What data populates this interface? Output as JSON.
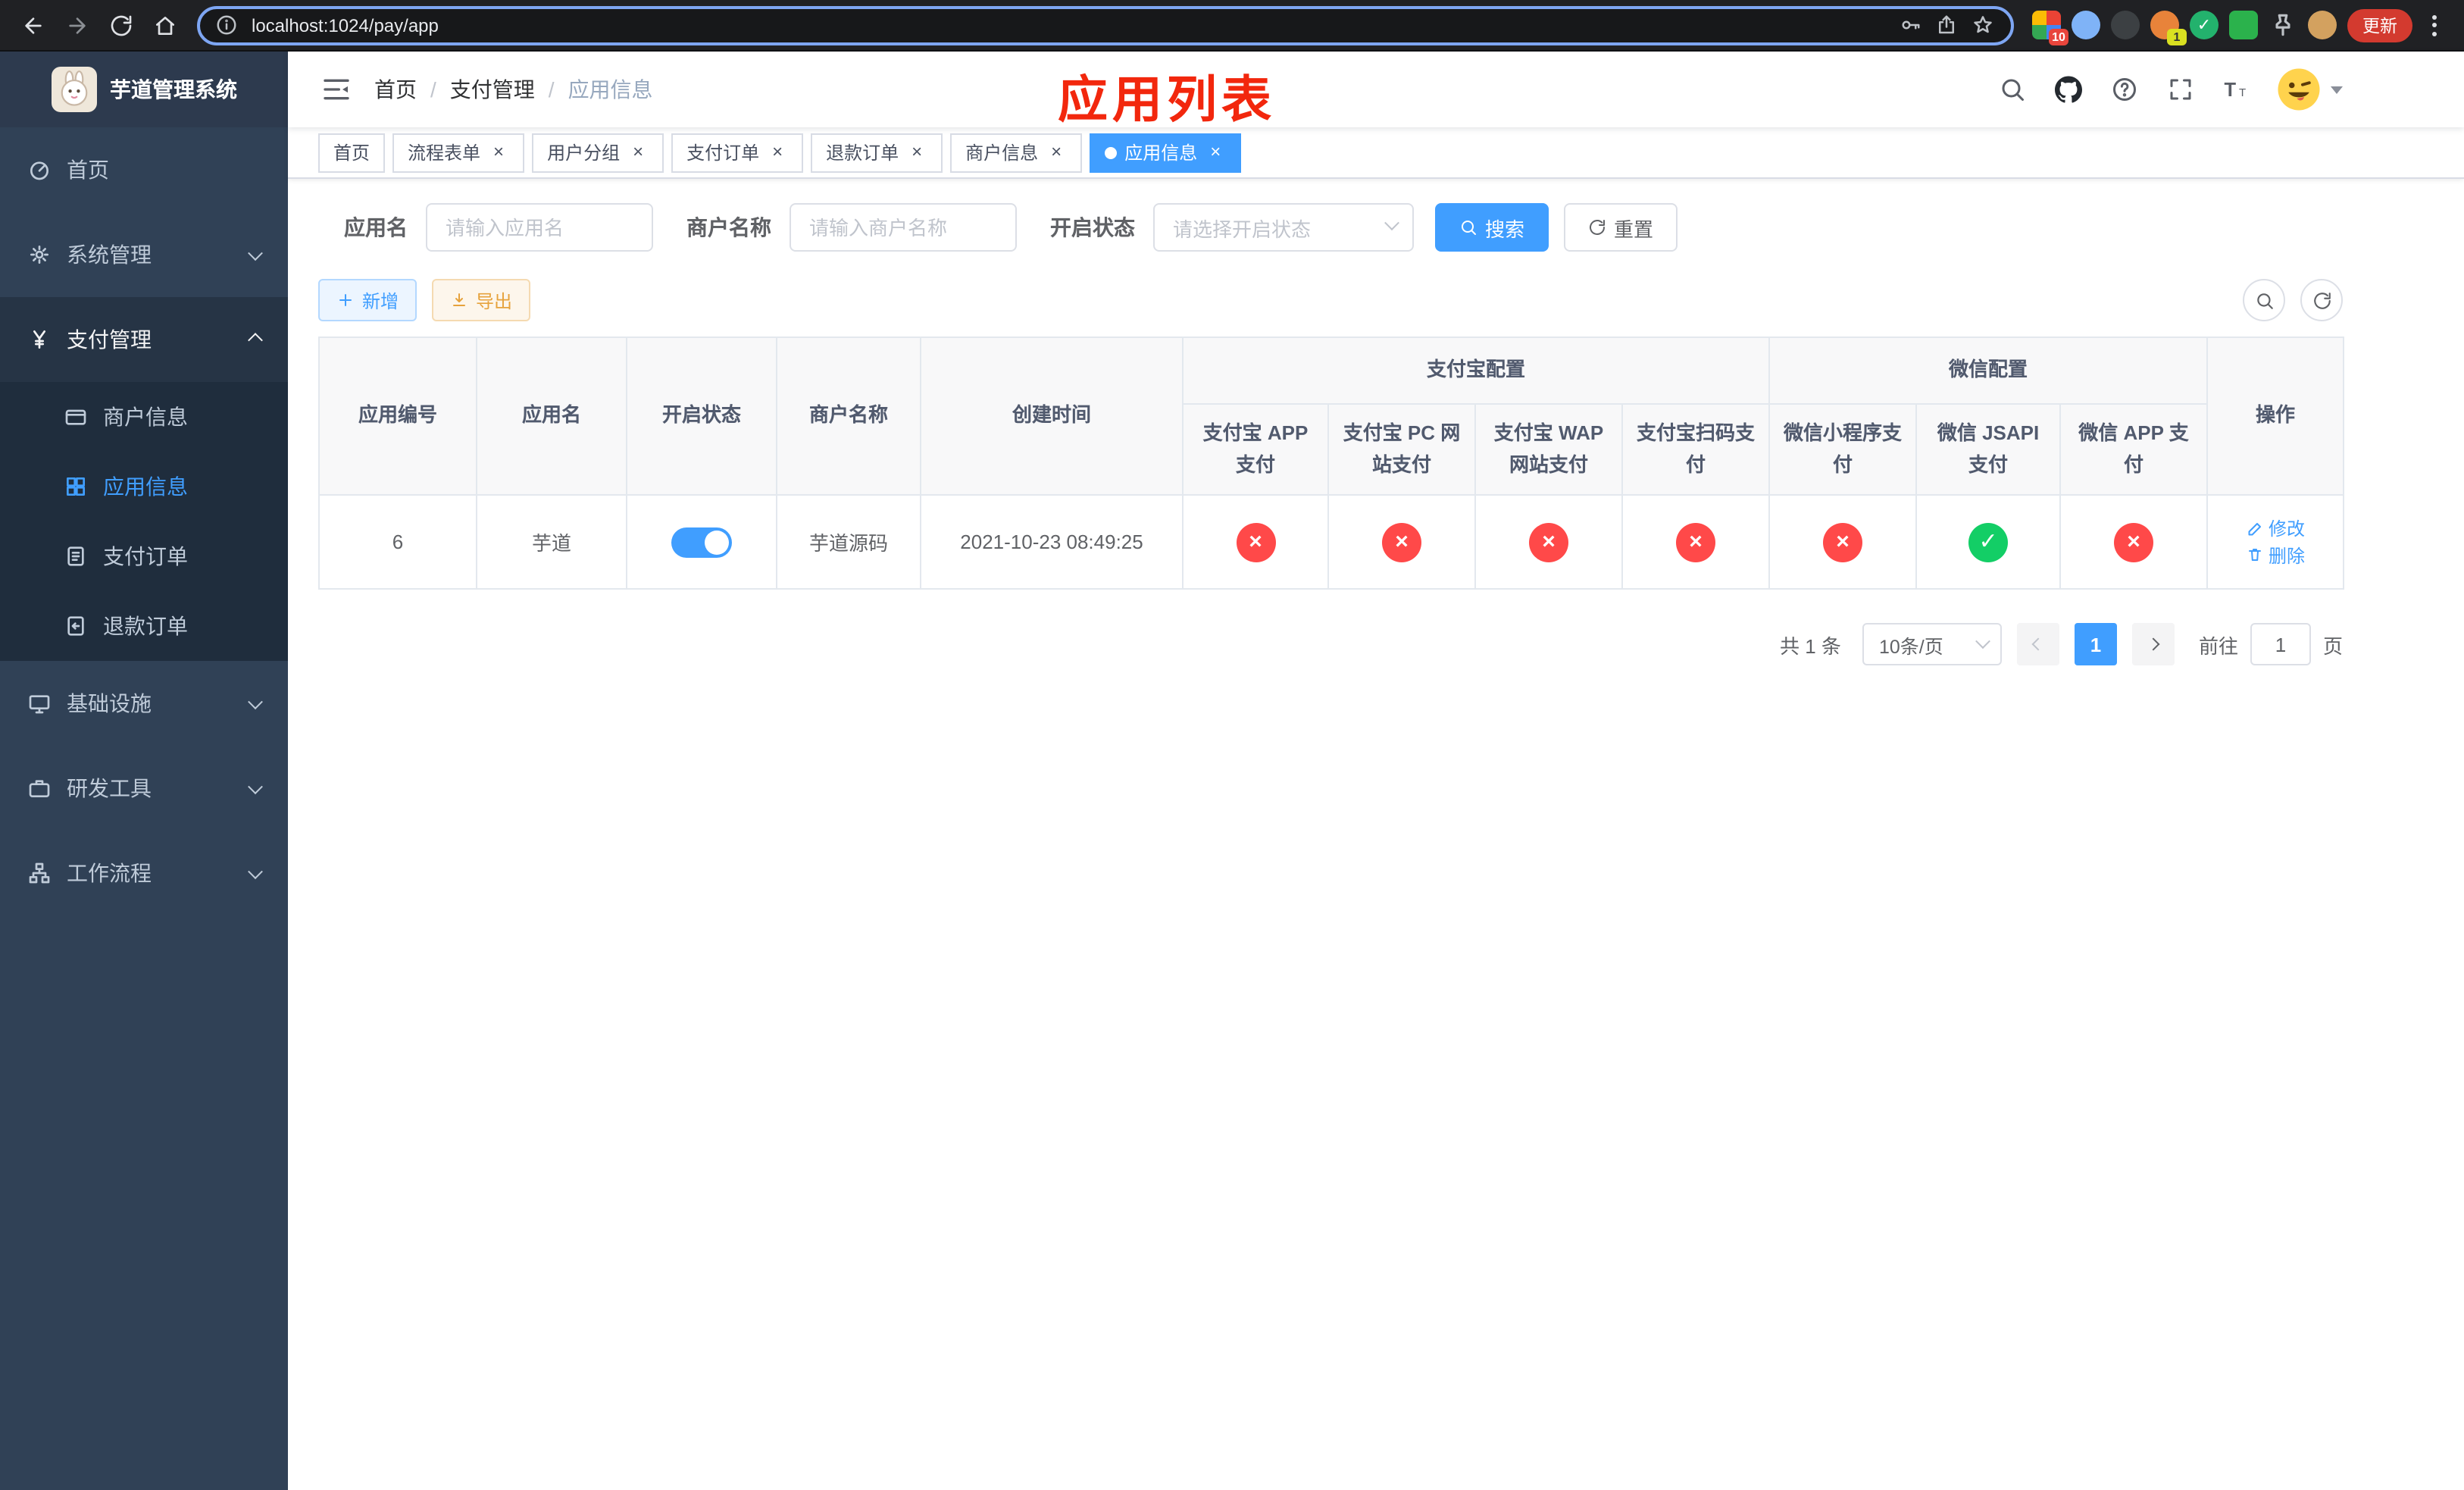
{
  "browser": {
    "url": "localhost:1024/pay/app",
    "update_button_label": "更新",
    "extension_badge_1": "10",
    "extension_badge_2": "1"
  },
  "sidebar": {
    "app_title": "芋道管理系统",
    "menu": {
      "home": "首页",
      "system": "系统管理",
      "payment": "支付管理",
      "merchant_info": "商户信息",
      "app_info": "应用信息",
      "pay_order": "支付订单",
      "refund_order": "退款订单",
      "infrastructure": "基础设施",
      "dev_tools": "研发工具",
      "workflow": "工作流程"
    }
  },
  "navbar": {
    "breadcrumb": {
      "level1": "首页",
      "level2": "支付管理",
      "level3": "应用信息"
    },
    "annotation_title": "应用列表"
  },
  "tabs": [
    {
      "label": "首页",
      "closable": false,
      "active": false
    },
    {
      "label": "流程表单",
      "closable": true,
      "active": false
    },
    {
      "label": "用户分组",
      "closable": true,
      "active": false
    },
    {
      "label": "支付订单",
      "closable": true,
      "active": false
    },
    {
      "label": "退款订单",
      "closable": true,
      "active": false
    },
    {
      "label": "商户信息",
      "closable": true,
      "active": false
    },
    {
      "label": "应用信息",
      "closable": true,
      "active": true
    }
  ],
  "filters": {
    "app_name": {
      "label": "应用名",
      "placeholder": "请输入应用名",
      "value": ""
    },
    "merchant_name": {
      "label": "商户名称",
      "placeholder": "请输入商户名称",
      "value": ""
    },
    "status": {
      "label": "开启状态",
      "placeholder": "请选择开启状态",
      "value": ""
    },
    "search_button": "搜索",
    "reset_button": "重置"
  },
  "toolbar": {
    "add_button": "新增",
    "export_button": "导出"
  },
  "table": {
    "group_headers": {
      "alipay": "支付宝配置",
      "wechat": "微信配置"
    },
    "headers": {
      "app_id": "应用编号",
      "app_name": "应用名",
      "status": "开启状态",
      "merchant_name": "商户名称",
      "create_time": "创建时间",
      "alipay_app": "支付宝 APP 支付",
      "alipay_pc": "支付宝 PC 网站支付",
      "alipay_wap": "支付宝 WAP 网站支付",
      "alipay_qr": "支付宝扫码支付",
      "wechat_mini": "微信小程序支付",
      "wechat_jsapi": "微信 JSAPI 支付",
      "wechat_app": "微信 APP 支付",
      "actions": "操作"
    },
    "rows": [
      {
        "app_id": "6",
        "app_name": "芋道",
        "status_on": true,
        "merchant_name": "芋道源码",
        "create_time": "2021-10-23 08:49:25",
        "configs": {
          "alipay_app": false,
          "alipay_pc": false,
          "alipay_wap": false,
          "alipay_qr": false,
          "wechat_mini": false,
          "wechat_jsapi": true,
          "wechat_app": false
        },
        "edit_label": "修改",
        "delete_label": "删除"
      }
    ]
  },
  "pagination": {
    "total_text": "共 1 条",
    "page_size_text": "10条/页",
    "current_page": "1",
    "goto_prefix": "前往",
    "goto_value": "1",
    "goto_suffix": "页"
  },
  "colors": {
    "primary": "#409eff",
    "success": "#13ce66",
    "danger": "#ff4949",
    "warning": "#e6a23c",
    "annotation_red": "#f2270d"
  }
}
